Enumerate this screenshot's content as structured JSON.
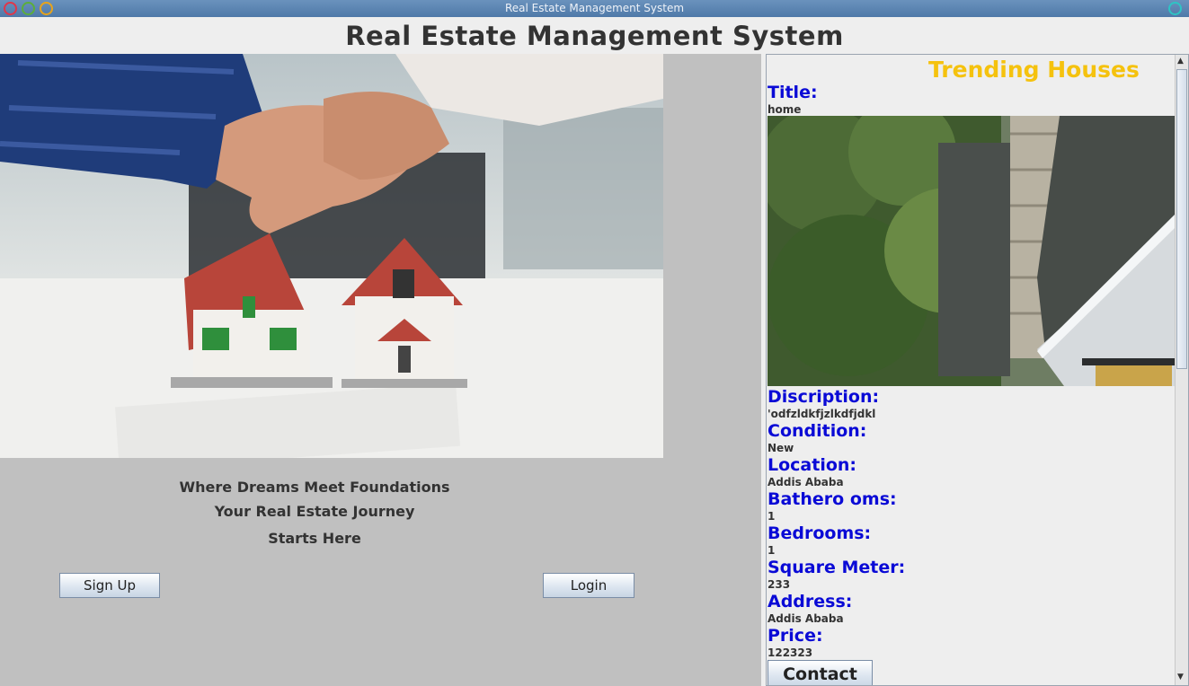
{
  "window": {
    "title": "Real Estate Management System"
  },
  "header": {
    "title": "Real Estate Management System"
  },
  "left": {
    "tagline": [
      "Where Dreams Meet Foundations",
      "Your Real Estate Journey",
      "Starts Here"
    ],
    "signup_label": "Sign Up",
    "login_label": "Login"
  },
  "listing": {
    "heading": "Trending Houses",
    "fields": [
      {
        "label": "Title:",
        "value": "home"
      },
      {
        "label": "Discription:",
        "value": "'odfzldkfjzlkdfjdkl"
      },
      {
        "label": "Condition:",
        "value": "New"
      },
      {
        "label": "Location:",
        "value": "Addis Ababa"
      },
      {
        "label": "Bathero oms:",
        "value": "1"
      },
      {
        "label": "Bedrooms:",
        "value": "1"
      },
      {
        "label": "Square Meter:",
        "value": "233"
      },
      {
        "label": "Address:",
        "value": "Addis Ababa"
      },
      {
        "label": "Price:",
        "value": "122323"
      }
    ],
    "contact_label": "Contact"
  },
  "colors": {
    "label": "#0a0ad6",
    "heading": "#f5c20e",
    "panel": "#c0c0c0"
  },
  "icons": [
    "close-icon",
    "minimize-icon",
    "maximize-icon",
    "restore-icon",
    "scroll-up-icon",
    "scroll-down-icon"
  ]
}
